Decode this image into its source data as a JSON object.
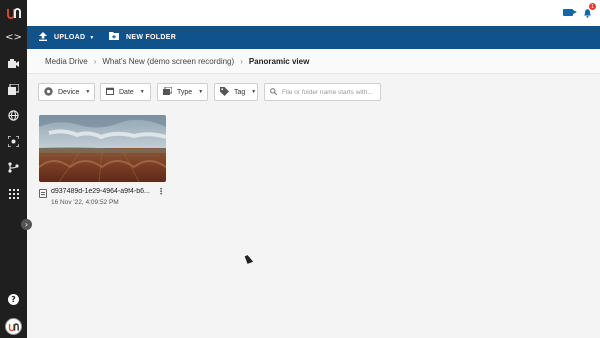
{
  "rail": {
    "icons": [
      "code-icon",
      "camera-icon",
      "photos-icon",
      "globe-icon",
      "scan-icon",
      "workflow-icon",
      "apps-grid-icon"
    ],
    "help_glyph": "?"
  },
  "topbar": {
    "notification_count": "1"
  },
  "actions": {
    "upload_label": "UPLOAD",
    "new_folder_label": "NEW FOLDER"
  },
  "breadcrumb": {
    "items": [
      "Media Drive",
      "What's New (demo screen recording)",
      "Panoramic view"
    ]
  },
  "filters": {
    "device": "Device",
    "date": "Date",
    "type": "Type",
    "tag": "Tag",
    "search_placeholder": "File or folder name starts with..."
  },
  "file": {
    "name": "d937489d-1e29-4964-a9f4-b6...",
    "date": "16 Nov '22, 4:09:52 PM"
  },
  "colors": {
    "accent": "#10528c",
    "rail": "#1f1f1f",
    "brand": "#e24a3b"
  }
}
